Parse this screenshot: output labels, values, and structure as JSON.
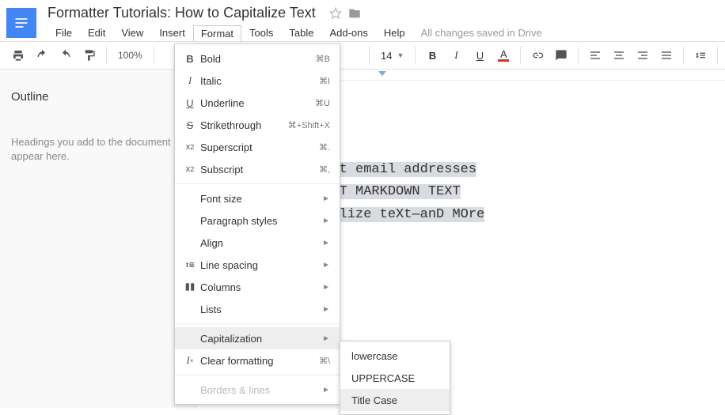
{
  "doc_title": "Formatter Tutorials: How to Capitalize Text",
  "menubar": {
    "file": "File",
    "edit": "Edit",
    "view": "View",
    "insert": "Insert",
    "format": "Format",
    "tools": "Tools",
    "table": "Table",
    "addons": "Add-ons",
    "help": "Help",
    "save_status": "All changes saved in Drive"
  },
  "toolbar": {
    "zoom": "100%",
    "font_size": "14"
  },
  "outline": {
    "title": "Outline",
    "empty_msg": "Headings you add to the document appear here."
  },
  "document_lines": {
    "l1": "how to extract email addresses",
    "l2": "HOW TO CONVERT MARKDOWN TEXT",
    "l3": "HOw to cApitalize teXt—anD MOre"
  },
  "format_menu": {
    "bold": "Bold",
    "bold_sc": "⌘B",
    "italic": "Italic",
    "italic_sc": "⌘I",
    "underline": "Underline",
    "underline_sc": "⌘U",
    "strike": "Strikethrough",
    "strike_sc": "⌘+Shift+X",
    "superscript": "Superscript",
    "superscript_sc": "⌘.",
    "subscript": "Subscript",
    "subscript_sc": "⌘,",
    "fontsize": "Font size",
    "parstyles": "Paragraph styles",
    "align": "Align",
    "linesp": "Line spacing",
    "columns": "Columns",
    "lists": "Lists",
    "capitalization": "Capitalization",
    "clearfmt": "Clear formatting",
    "clearfmt_sc": "⌘\\",
    "borders": "Borders & lines"
  },
  "cap_submenu": {
    "lower": "lowercase",
    "upper": "UPPERCASE",
    "title": "Title Case"
  }
}
